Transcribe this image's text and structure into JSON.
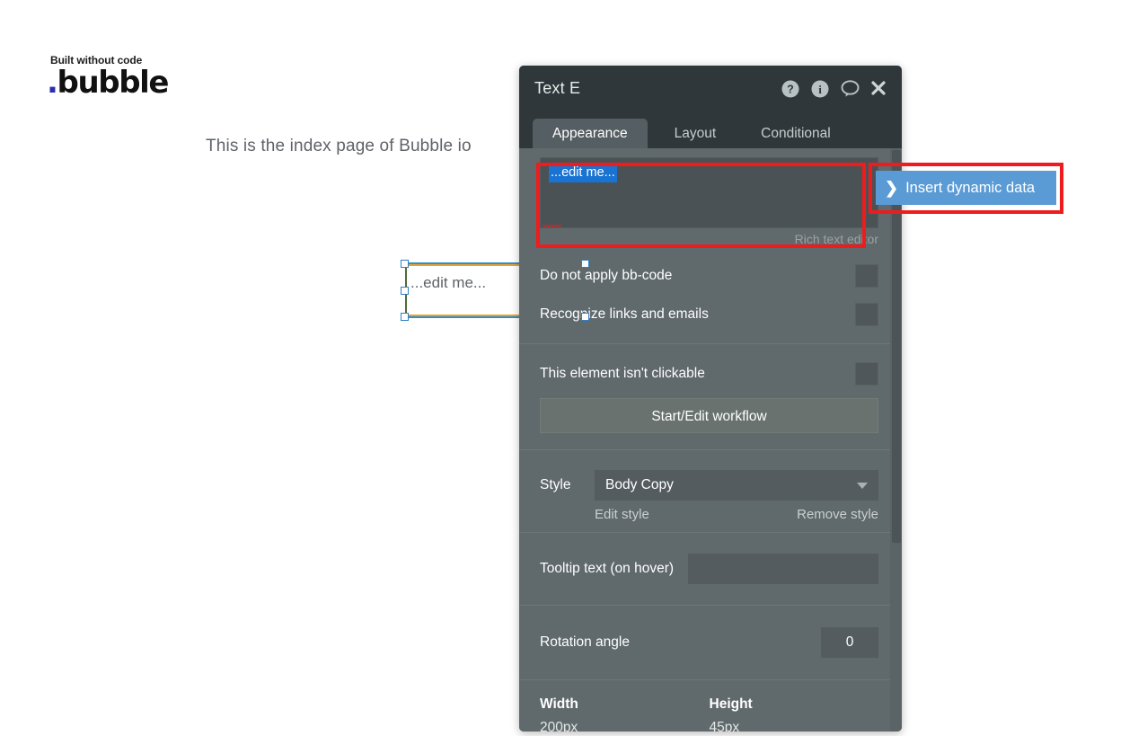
{
  "logo": {
    "tagline": "Built without code",
    "dot": ".",
    "word": "bubble"
  },
  "canvas": {
    "page_text": "This is the index page of Bubble io",
    "element_text": "...edit me..."
  },
  "panel": {
    "title": "Text E",
    "header_icons": [
      {
        "name": "help-icon",
        "glyph": "?"
      },
      {
        "name": "info-icon",
        "glyph": "i"
      },
      {
        "name": "comment-icon",
        "glyph": "comment"
      },
      {
        "name": "close-icon",
        "glyph": "✕"
      }
    ],
    "tabs": [
      {
        "label": "Appearance",
        "active": true
      },
      {
        "label": "Layout",
        "active": false
      },
      {
        "label": "Conditional",
        "active": false
      }
    ],
    "rich_text": {
      "value": "...edit me...",
      "caption": "Rich text editor"
    },
    "insert_dynamic_data": {
      "label": "Insert dynamic data",
      "chevron": "❯",
      "color": "#5b9bd5"
    },
    "checkboxes": [
      {
        "label": "Do not apply bb-code",
        "checked": false
      },
      {
        "label": "Recognize links and emails",
        "checked": false
      },
      {
        "label": "This element isn't clickable",
        "checked": false
      }
    ],
    "workflow_button": "Start/Edit workflow",
    "style": {
      "label": "Style",
      "value": "Body Copy",
      "edit_link": "Edit style",
      "remove_link": "Remove style"
    },
    "tooltip": {
      "label": "Tooltip text (on hover)",
      "value": "",
      "placeholder": ""
    },
    "rotation": {
      "label": "Rotation angle",
      "value": "0"
    },
    "dimensions": {
      "width_label": "Width",
      "width_value": "200px",
      "height_label": "Height",
      "height_value": "45px"
    }
  },
  "annotations": {
    "color": "#ee1c1c",
    "boxes": [
      "rich-text-editor",
      "insert-dynamic-data-button"
    ]
  }
}
